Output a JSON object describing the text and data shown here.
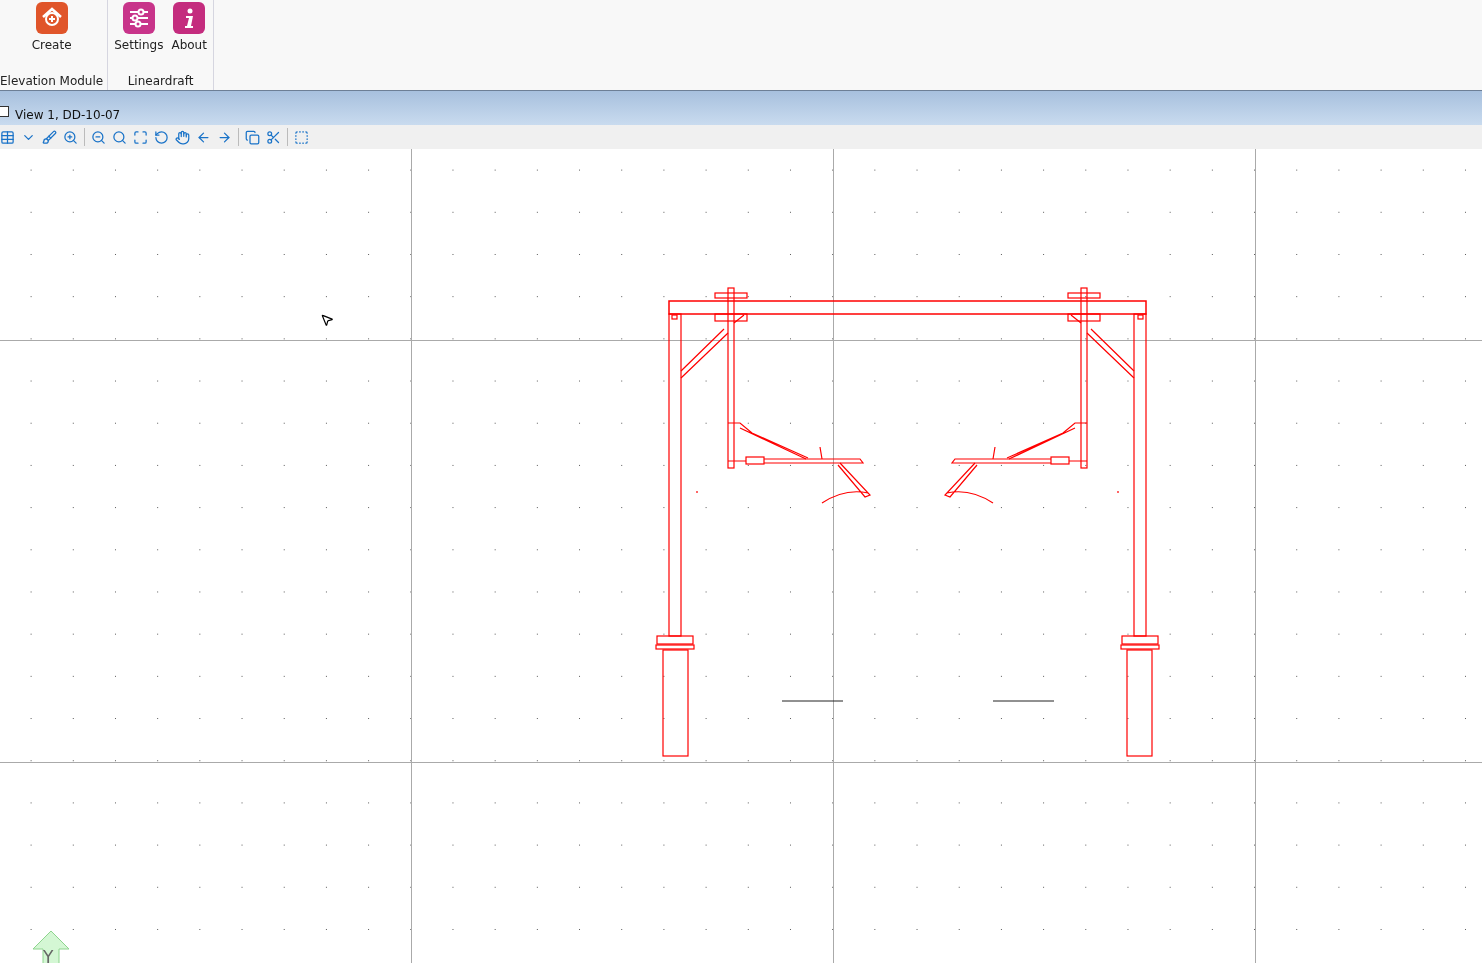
{
  "ribbon": {
    "groups": [
      {
        "label": "Elevation Module",
        "buttons": [
          {
            "label": "Create",
            "kind": "create"
          }
        ]
      },
      {
        "label": "Lineardraft",
        "buttons": [
          {
            "label": "Settings",
            "kind": "settings"
          },
          {
            "label": "About",
            "kind": "about"
          }
        ]
      }
    ]
  },
  "view": {
    "title": "View 1, DD-10-07"
  },
  "canvas": {
    "axis_label": "Y"
  }
}
